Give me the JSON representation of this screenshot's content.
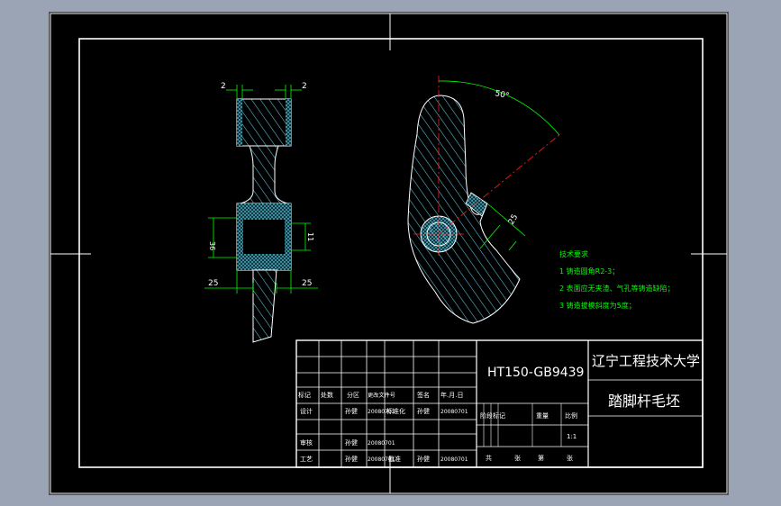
{
  "dimensions": {
    "left_top_left": "2",
    "left_top_right": "2",
    "left_bore_dia": "36",
    "left_bore_right": "11",
    "left_bottom_left": "25",
    "left_bottom_right": "25",
    "right_angle": "50°",
    "right_thickness": "25"
  },
  "tech_requirements": {
    "title": "技术要求",
    "items": [
      "1 铸造圆角R2-3；",
      "2 表面应无夹渣、气孔等铸造缺陷；",
      "3 铸造拔模斜度为5度；"
    ]
  },
  "title_block": {
    "material": "HT150-GB9439",
    "company": "辽宁工程技术大学",
    "part_name": "踏脚杆毛坯",
    "header": [
      "标记",
      "处数",
      "分区",
      "更改文件号",
      "签名",
      "年.月.日"
    ],
    "design_label": "设计",
    "design_name": "孙健",
    "design_date": "20080701",
    "std_label": "标准化",
    "std_name": "孙健",
    "std_date": "20080701",
    "stage_labels": [
      "阶段标记",
      "重量",
      "比例"
    ],
    "scale": "1:1",
    "review_label": "审核",
    "review_name": "孙健",
    "review_date": "20080701",
    "process_label": "工艺",
    "process_name": "孙健",
    "process_date": "20080701",
    "approve_label": "批准",
    "approve_name": "孙健",
    "approve_date": "20080701",
    "sheets": [
      "共",
      "张",
      "第",
      "张"
    ]
  },
  "colors": {
    "background": "#000000",
    "frame": "#ffffff",
    "hatch": "#5fc8e6",
    "dimension": "#00ff00",
    "centerline": "#ff2020",
    "text_green": "#00ff00"
  }
}
